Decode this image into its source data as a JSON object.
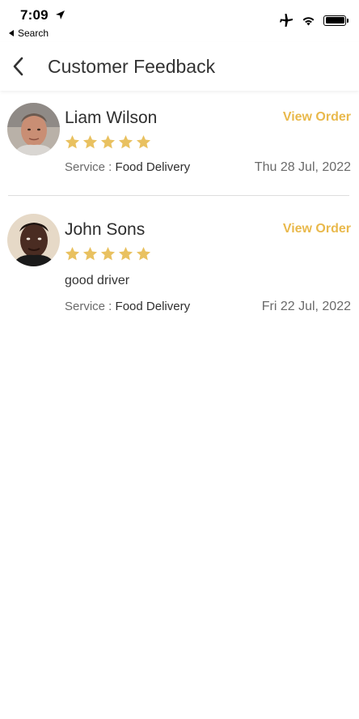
{
  "status_bar": {
    "time": "7:09",
    "back_label": "Search",
    "icons": [
      "location-arrow-icon",
      "airplane-icon",
      "wifi-icon",
      "battery-icon"
    ]
  },
  "header": {
    "title": "Customer Feedback",
    "back_icon": "chevron-left-icon"
  },
  "colors": {
    "accent": "#e9b94c",
    "star": "#e9c160"
  },
  "reviews": [
    {
      "name": "Liam Wilson",
      "action": "View Order",
      "rating": 5,
      "comment": "",
      "service_label": "Service :",
      "service_value": "Food Delivery",
      "date": "Thu 28 Jul, 2022"
    },
    {
      "name": "John Sons",
      "action": "View Order",
      "rating": 5,
      "comment": "good driver",
      "service_label": "Service :",
      "service_value": "Food Delivery",
      "date": "Fri 22 Jul, 2022"
    }
  ]
}
